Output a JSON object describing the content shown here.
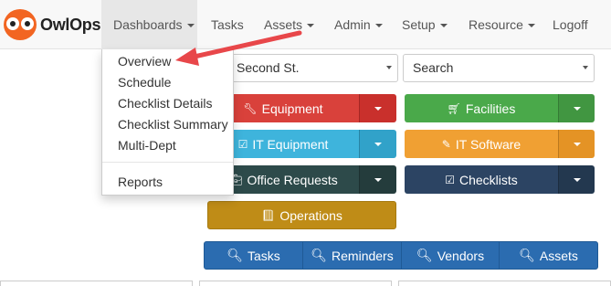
{
  "brand": {
    "name": "OwlOps"
  },
  "nav": {
    "dashboards": "Dashboards",
    "tasks": "Tasks",
    "assets": "Assets",
    "admin": "Admin",
    "setup": "Setup",
    "resource": "Resource",
    "logoff": "Logoff"
  },
  "dashboards_menu": {
    "overview": "Overview",
    "schedule": "Schedule",
    "checklist_details": "Checklist Details",
    "checklist_summary": "Checklist Summary",
    "multi_dept": "Multi-Dept",
    "reports": "Reports"
  },
  "filters": {
    "location": "Second St.",
    "search": "Search"
  },
  "buttons": {
    "equipment": "Equipment",
    "facilities": "Facilities",
    "it_equipment": "IT Equipment",
    "it_software": "IT Software",
    "office_requests": "Office Requests",
    "checklists": "Checklists",
    "operations": "Operations"
  },
  "quick_links": {
    "tasks": "Tasks",
    "reminders": "Reminders",
    "vendors": "Vendors",
    "assets": "Assets"
  },
  "icons": {
    "equipment": "wrench-icon",
    "facilities": "cart-icon",
    "it_equipment": "checkbox-icon",
    "it_software": "pencil-icon",
    "office_requests": "briefcase-icon",
    "checklists": "checkbox-icon",
    "operations": "book-icon",
    "search": "search-icon"
  },
  "colors": {
    "brand_orange": "#f26522",
    "equipment": "#d9413b",
    "facilities": "#4aa94a",
    "it_equipment": "#3eb4dc",
    "it_software": "#f0a033",
    "office_requests": "#2d4a4a",
    "checklists": "#2c4463",
    "operations": "#bf8c17",
    "quick_links": "#2b6cb0",
    "pointer_arrow": "#e8474a"
  }
}
